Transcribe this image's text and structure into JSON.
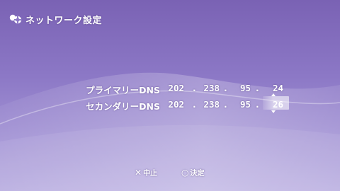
{
  "header": {
    "title": "ネットワーク設定",
    "icon": "network-settings-icon"
  },
  "dns": {
    "primary": {
      "label": "プライマリーDNS",
      "octets": [
        "202",
        "238",
        "95",
        "24"
      ]
    },
    "secondary": {
      "label": "セカンダリーDNS",
      "octets": [
        "202",
        "238",
        "95",
        "26"
      ]
    },
    "separator": "."
  },
  "footer": {
    "cancel_glyph": "✕",
    "cancel_label": "中止",
    "ok_glyph": "○",
    "ok_label": "決定"
  },
  "colors": {
    "background_top": "#7a62b4",
    "background_bottom": "#b6aadf",
    "text": "#ffffff"
  }
}
